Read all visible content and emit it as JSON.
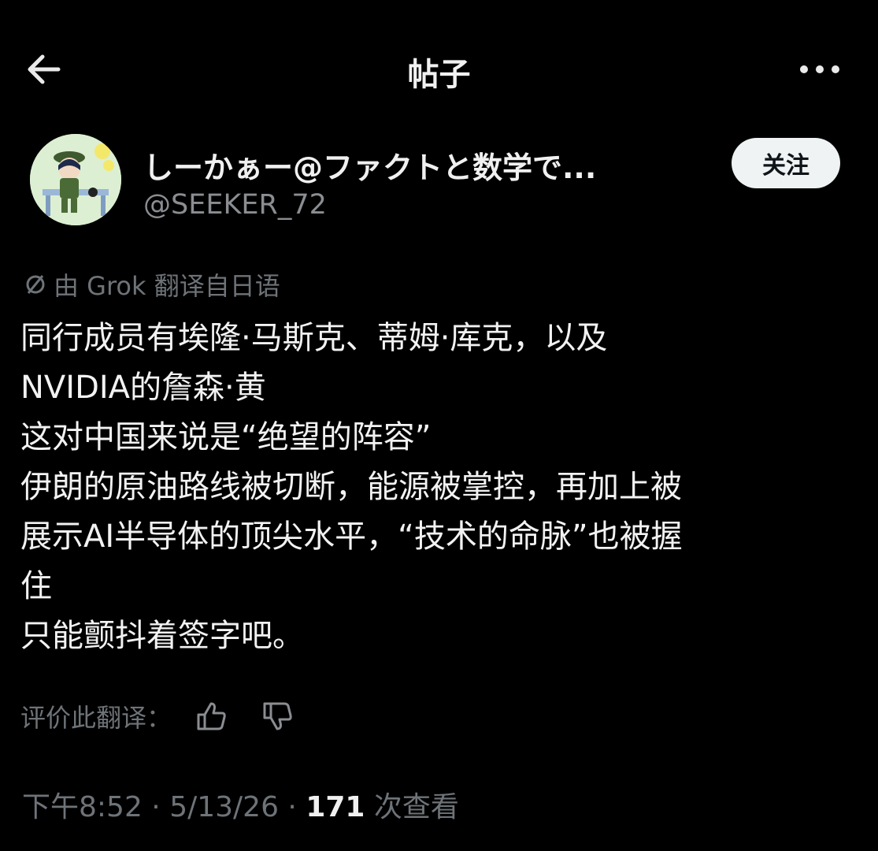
{
  "header": {
    "title": "帖子"
  },
  "author": {
    "display_name": "しーかぁー@ファクトと数学で...",
    "handle": "@SEEKER_72",
    "follow_label": "关注"
  },
  "translation": {
    "note": "由 Grok 翻译自日语"
  },
  "post": {
    "lines": [
      "同行成员有埃隆·马斯克、蒂姆·库克，以及",
      "NVIDIA的詹森·黄",
      "这对中国来说是“绝望的阵容”",
      "伊朗的原油路线被切断，能源被掌控，再加上被",
      "展示AI半导体的顶尖水平，“技术的命脉”也被握",
      "住",
      "只能颤抖着签字吧。"
    ]
  },
  "rating": {
    "label": "评价此翻译："
  },
  "meta": {
    "time": "下午8:52",
    "separator": " · ",
    "date": "5/13/26",
    "views_count": "171",
    "views_label": " 次查看"
  }
}
